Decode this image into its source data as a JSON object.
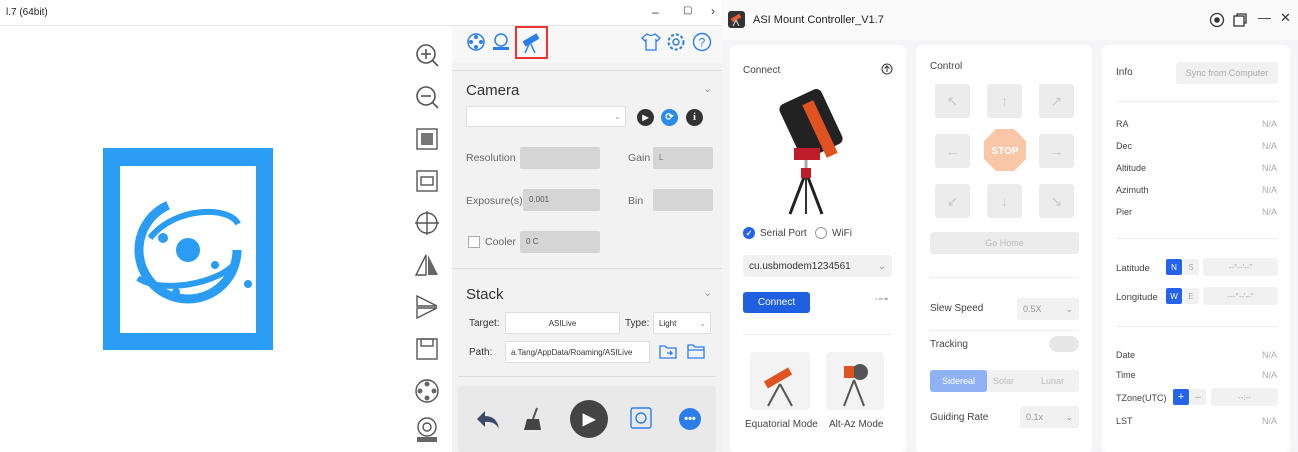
{
  "left_app": {
    "title": "l.7 (64bit)",
    "window_controls": {
      "minimize": "–",
      "maximize": "▢",
      "more": "›"
    },
    "camera": {
      "section_title": "Camera",
      "resolution_label": "Resolution",
      "gain_label": "Gain",
      "gain_value": "L",
      "exposure_label": "Exposure(s)",
      "exposure_value": "0.001",
      "bin_label": "Bin",
      "cooler_label": "Cooler",
      "cooler_value": "0 C"
    },
    "stack": {
      "section_title": "Stack",
      "target_label": "Target:",
      "target_value": "ASILive",
      "type_label": "Type:",
      "type_value": "Light",
      "path_label": "Path:",
      "path_value": "a.Tang/AppData/Roaming/ASILive"
    }
  },
  "right_app": {
    "title": "ASI Mount Controller_V1.7",
    "window_controls": {
      "minimize": "—",
      "close": "✕"
    },
    "connect": {
      "heading": "Connect",
      "serial_port_label": "Serial Port",
      "wifi_label": "WiFi",
      "port_value": "cu.usbmodem1234561",
      "connect_button": "Connect",
      "equatorial_label": "Equatorial Mode",
      "altaz_label": "Alt-Az Mode"
    },
    "control": {
      "heading": "Control",
      "stop_label": "STOP",
      "go_home_label": "Go Home",
      "slew_speed_label": "Slew Speed",
      "slew_speed_value": "0.5X",
      "tracking_label": "Tracking",
      "tracking_modes": [
        "Sidereal",
        "Solar",
        "Lunar"
      ],
      "guiding_rate_label": "Guiding Rate",
      "guiding_rate_value": "0.1x"
    },
    "info": {
      "heading": "Info",
      "sync_button": "Sync from Computer",
      "rows": [
        {
          "label": "RA",
          "value": "N/A"
        },
        {
          "label": "Dec",
          "value": "N/A"
        },
        {
          "label": "Altitude",
          "value": "N/A"
        },
        {
          "label": "Azimuth",
          "value": "N/A"
        },
        {
          "label": "Pier",
          "value": "N/A"
        }
      ],
      "latitude_label": "Latitude",
      "lat_n": "N",
      "lat_s": "S",
      "latitude_value": "--°--'--\"",
      "longitude_label": "Longitude",
      "lon_w": "W",
      "lon_e": "E",
      "longitude_value": "---°--'--\"",
      "date_label": "Date",
      "date_value": "N/A",
      "time_label": "Time",
      "time_value": "N/A",
      "tzone_label": "TZone(UTC)",
      "tz_plus": "+",
      "tz_minus": "–",
      "tzone_value": "--:--",
      "lst_label": "LST",
      "lst_value": "N/A"
    }
  }
}
